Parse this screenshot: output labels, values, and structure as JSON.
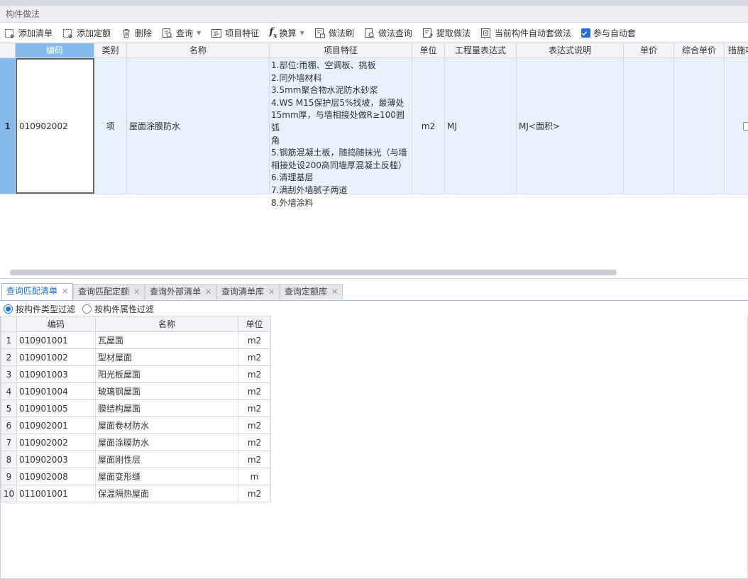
{
  "panel": {
    "title": "构件做法"
  },
  "toolbar": {
    "add_list": "添加清单",
    "add_quota": "添加定额",
    "delete": "删除",
    "query": "查询",
    "item_features": "项目特征",
    "convert": "换算",
    "method_brush": "做法刷",
    "method_query": "做法查询",
    "extract_method": "提取做法",
    "auto_apply_current": "当前构件自动套做法",
    "participate_auto": "参与自动套",
    "participate_auto_checked": true
  },
  "upper_grid": {
    "columns": [
      "编码",
      "类别",
      "名称",
      "项目特征",
      "单位",
      "工程量表达式",
      "表达式说明",
      "单价",
      "综合单价",
      "措施项"
    ],
    "rows": [
      {
        "num": "1",
        "code": "010902002",
        "category": "项",
        "name": "屋面涂膜防水",
        "features": [
          "1.部位:雨棚、空调板、挑板",
          "2.同外墙材料",
          "3.5mm聚合物水泥防水砂浆",
          "4.WS M15保护层5%找坡，最薄处",
          "15mm厚，与墙相接处做R≥100圆弧",
          "角",
          "5.钢筋混凝土板，随捣随抹光（与墙",
          "相接处设200高同墙厚混凝土反槛）",
          "6.清理基层",
          "7.满刮外墙腻子两道",
          "8.外墙涂料"
        ],
        "unit": "m2",
        "qty_expr": "MJ",
        "expr_desc": "MJ<面积>",
        "price": "",
        "composite_price": ""
      }
    ]
  },
  "tabs": [
    {
      "label": "查询匹配清单",
      "active": true
    },
    {
      "label": "查询匹配定额",
      "active": false
    },
    {
      "label": "查询外部清单",
      "active": false
    },
    {
      "label": "查询清单库",
      "active": false
    },
    {
      "label": "查询定额库",
      "active": false
    }
  ],
  "filter": {
    "by_type": "按构件类型过滤",
    "by_attr": "按构件属性过滤",
    "selected": "by_type"
  },
  "lower_grid": {
    "columns": [
      "编码",
      "名称",
      "单位"
    ],
    "rows": [
      {
        "num": "1",
        "code": "010901001",
        "name": "瓦屋面",
        "unit": "m2"
      },
      {
        "num": "2",
        "code": "010901002",
        "name": "型材屋面",
        "unit": "m2"
      },
      {
        "num": "3",
        "code": "010901003",
        "name": "阳光板屋面",
        "unit": "m2"
      },
      {
        "num": "4",
        "code": "010901004",
        "name": "玻璃钢屋面",
        "unit": "m2"
      },
      {
        "num": "5",
        "code": "010901005",
        "name": "膜结构屋面",
        "unit": "m2"
      },
      {
        "num": "6",
        "code": "010902001",
        "name": "屋面卷材防水",
        "unit": "m2"
      },
      {
        "num": "7",
        "code": "010902002",
        "name": "屋面涂膜防水",
        "unit": "m2"
      },
      {
        "num": "8",
        "code": "010902003",
        "name": "屋面刚性层",
        "unit": "m2"
      },
      {
        "num": "9",
        "code": "010902008",
        "name": "屋面变形缝",
        "unit": "m"
      },
      {
        "num": "10",
        "code": "011001001",
        "name": "保温隔热屋面",
        "unit": "m2"
      }
    ]
  },
  "colors": {
    "accent": "#1e6fd9",
    "header_active": "#86b9ee",
    "row_selected": "#e7f1fb"
  }
}
